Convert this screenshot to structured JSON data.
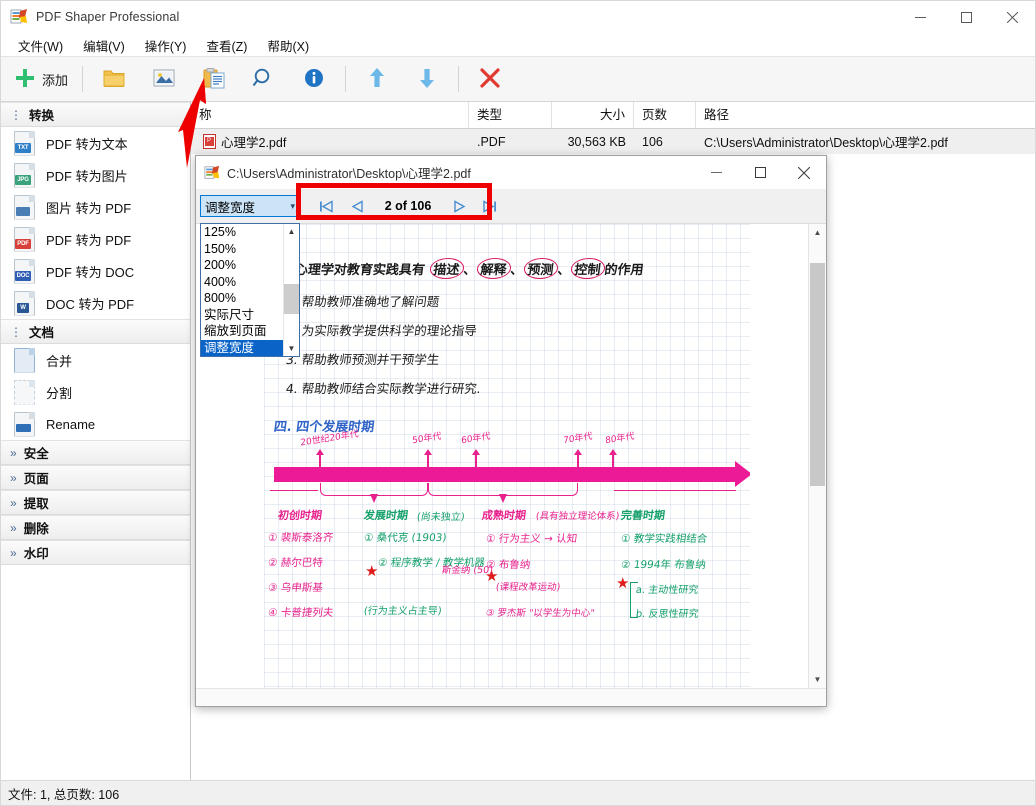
{
  "app": {
    "title": "PDF Shaper Professional",
    "window_controls": {
      "minimize": "—",
      "maximize": "□",
      "close": "✕"
    }
  },
  "menubar": {
    "items": [
      {
        "label": "文件(W)",
        "name": "menu-file"
      },
      {
        "label": "编辑(V)",
        "name": "menu-edit"
      },
      {
        "label": "操作(Y)",
        "name": "menu-action"
      },
      {
        "label": "查看(Z)",
        "name": "menu-view"
      },
      {
        "label": "帮助(X)",
        "name": "menu-help"
      }
    ]
  },
  "toolbar": {
    "add_label": "添加",
    "buttons": [
      {
        "icon": "plus-icon",
        "label": "添加"
      },
      {
        "icon": "folder-icon",
        "label": ""
      },
      {
        "icon": "image-icon",
        "label": ""
      },
      {
        "icon": "clipboard-icon",
        "label": ""
      },
      {
        "icon": "search-icon",
        "label": ""
      },
      {
        "icon": "info-icon",
        "label": ""
      },
      {
        "icon": "arrow-up-icon",
        "label": ""
      },
      {
        "icon": "arrow-down-icon",
        "label": ""
      },
      {
        "icon": "close-x-icon",
        "label": ""
      }
    ]
  },
  "sidebar": {
    "groups": [
      {
        "label": "转换",
        "name": "group-convert",
        "items": [
          {
            "label": "PDF 转为文本",
            "tag": "TXT",
            "tag_color": "#2f7fc9"
          },
          {
            "label": "PDF 转为图片",
            "tag": "JPG",
            "tag_color": "#3aa37b"
          },
          {
            "label": "图片 转为 PDF",
            "tag": "",
            "tag_color": "#4a7fb5"
          },
          {
            "label": "PDF 转为 PDF",
            "tag": "PDF",
            "tag_color": "#d8413a"
          },
          {
            "label": "PDF 转为 DOC",
            "tag": "DOC",
            "tag_color": "#2f5fb5"
          },
          {
            "label": "DOC 转为 PDF",
            "tag": "W",
            "tag_color": "#2b5797"
          }
        ]
      },
      {
        "label": "文档",
        "name": "group-document",
        "items": [
          {
            "label": "合并",
            "tag": "",
            "tag_color": "#9bb7d4"
          },
          {
            "label": "分割",
            "tag": "",
            "tag_color": "#c2cfdb"
          },
          {
            "label": "Rename",
            "tag": "",
            "tag_color": "#2f6fb5"
          }
        ]
      }
    ],
    "collapsed_groups": [
      {
        "label": "安全",
        "name": "group-security"
      },
      {
        "label": "页面",
        "name": "group-pages"
      },
      {
        "label": "提取",
        "name": "group-extract"
      },
      {
        "label": "删除",
        "name": "group-delete"
      },
      {
        "label": "水印",
        "name": "group-watermark"
      }
    ]
  },
  "filelist": {
    "columns": [
      "称",
      "类型",
      "大小",
      "页数",
      "路径"
    ],
    "rows": [
      {
        "name": "心理学2.pdf",
        "type": ".PDF",
        "size": "30,563 KB",
        "pages": "106",
        "path": "C:\\Users\\Administrator\\Desktop\\心理学2.pdf"
      }
    ]
  },
  "statusbar": {
    "text": "文件: 1, 总页数: 106"
  },
  "viewer": {
    "title": "C:\\Users\\Administrator\\Desktop\\心理学2.pdf",
    "window_controls": {
      "minimize": "—",
      "maximize": "□",
      "close": "✕"
    },
    "zoom": {
      "selected": "调整宽度",
      "options": [
        "125%",
        "150%",
        "200%",
        "400%",
        "800%",
        "实际尺寸",
        "缩放到页面",
        "调整宽度"
      ]
    },
    "nav": {
      "first": "⏮",
      "prev": "◀",
      "next": "▶",
      "last": "⏭",
      "page_text": "2 of 106",
      "current_page": 2,
      "total_pages": 106
    }
  },
  "document_page": {
    "heading": "作用",
    "intro": "教育心理学对教育实践具有",
    "intro_circled": [
      "描述",
      "解释",
      "预测",
      "控制"
    ],
    "intro_tail": "的作用",
    "list": [
      "1. 帮助教师准确地了解问题",
      "2. 为实际教学提供科学的理论指导",
      "3. 帮助教师预测并干预学生",
      "4. 帮助教师结合实际教学进行研究."
    ],
    "section": "四. 四个发展时期",
    "timeline": {
      "ticks": [
        "20世纪20年代",
        "50年代",
        "60年代",
        "70年代",
        "80年代"
      ],
      "periods": [
        {
          "title": "初创时期",
          "note": "",
          "items": [
            "① 裴斯泰洛齐",
            "② 赫尔巴特",
            "③ 乌申斯基",
            "④ 卡普捷列夫"
          ]
        },
        {
          "title": "发展时期",
          "note": "(尚未独立)",
          "items": [
            "① 桑代克 (1903)",
            "② 程序教学 / 教学机器",
            "(行为主义占主导)"
          ],
          "side": "斯金纳 (50)"
        },
        {
          "title": "成熟时期",
          "note": "(具有独立理论体系)",
          "items": [
            "① 行为主义 → 认知",
            "② 布鲁纳",
            "(课程改革运动)",
            "③ 罗杰斯 \"以学生为中心\""
          ]
        },
        {
          "title": "完善时期",
          "note": "",
          "items": [
            "① 教学实践相结合",
            "② 1994年 布鲁纳",
            "a. 主动性研究",
            "b. 反思性研究"
          ]
        }
      ]
    }
  },
  "annotations": {
    "red_arrow": {
      "points_to": "search-icon"
    },
    "red_box": {
      "highlights": "page-navigation"
    }
  },
  "colors": {
    "accent_blue": "#0078d7",
    "annotation_red": "#ef0000",
    "selection_blue": "#0a64c8",
    "timeline_pink": "#ec1a96"
  }
}
